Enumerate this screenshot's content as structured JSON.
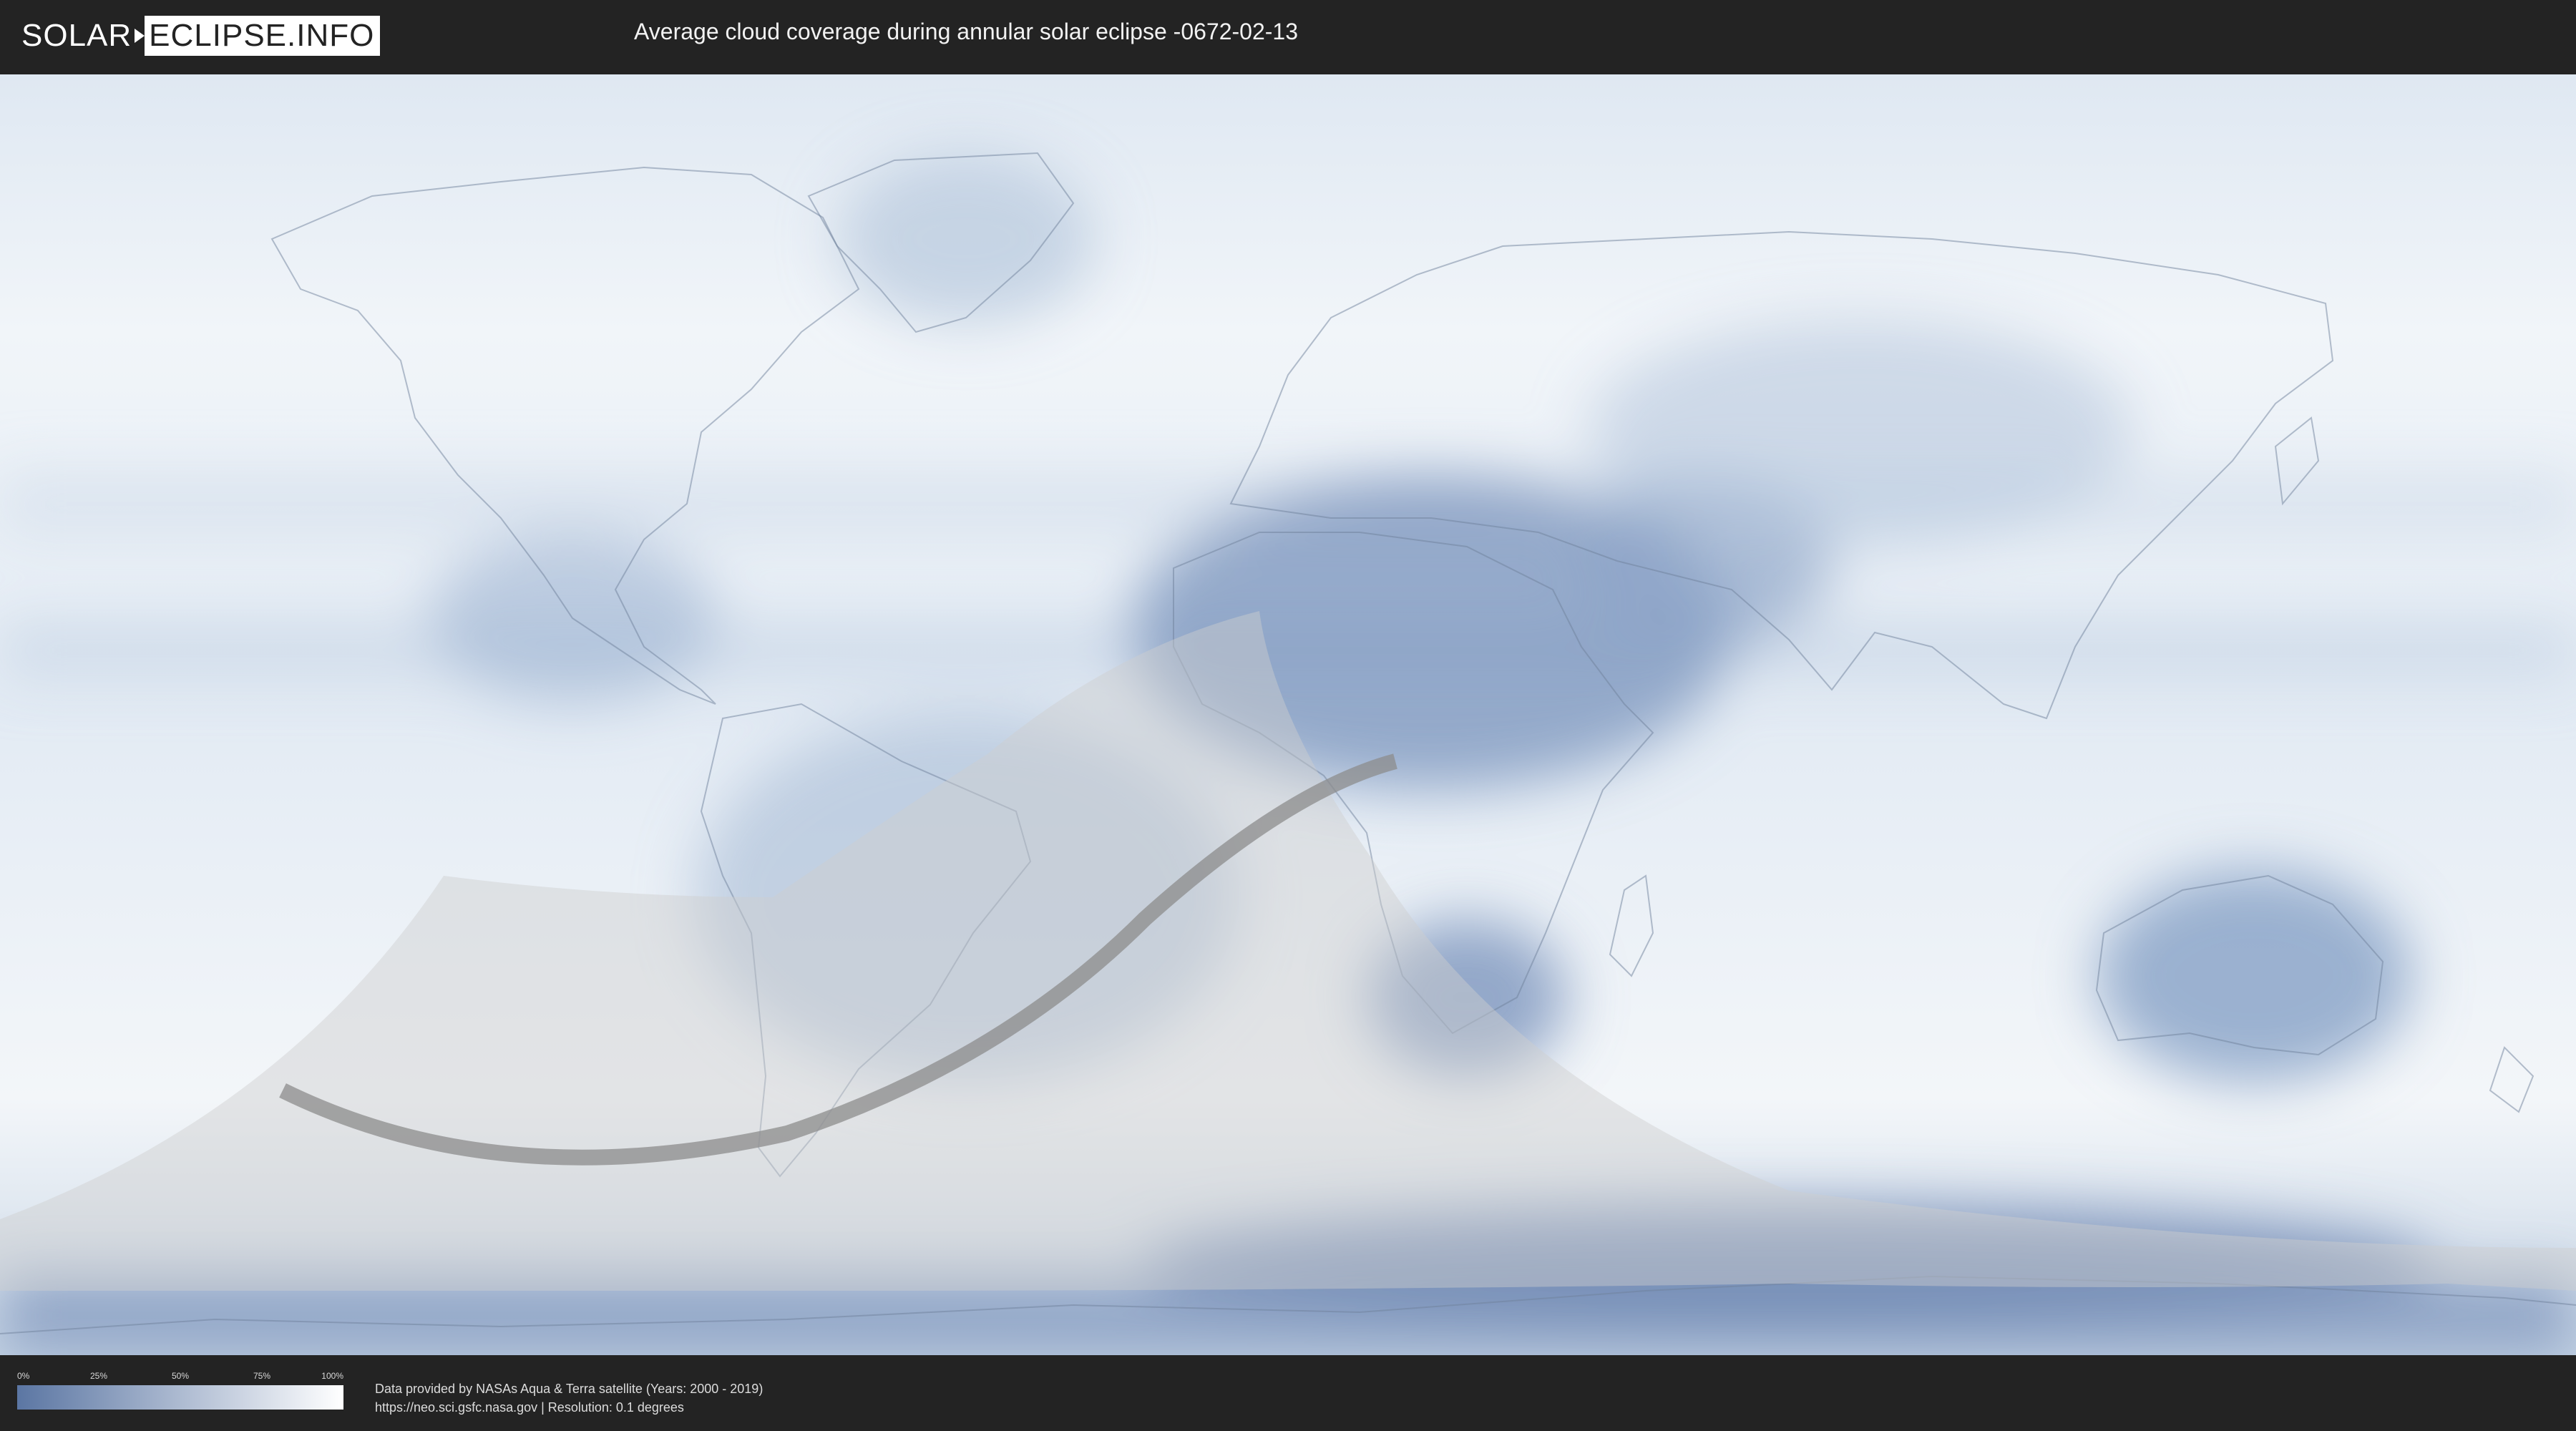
{
  "header": {
    "logo_left": "SOLAR",
    "logo_right": "ECLIPSE.INFO",
    "title": "Average cloud coverage during annular solar eclipse -0672-02-13"
  },
  "legend": {
    "ticks": [
      "0%",
      "25%",
      "50%",
      "75%",
      "100%"
    ],
    "color_low": "#5b76a3",
    "color_high": "#ffffff"
  },
  "credits": {
    "line1": "Data provided by NASAs Aqua & Terra satellite (Years: 2000 - 2019)",
    "line2": "https://neo.sci.gsfc.nasa.gov | Resolution: 0.1 degrees"
  },
  "colors": {
    "background": "#232323",
    "cloud_dense": "#ffffff",
    "cloud_sparse": "#5b76a3",
    "visibility_zone": "#d2d2d2",
    "central_path": "#8c8c8c"
  },
  "icons": {
    "logo": "logo-arrow-icon"
  }
}
